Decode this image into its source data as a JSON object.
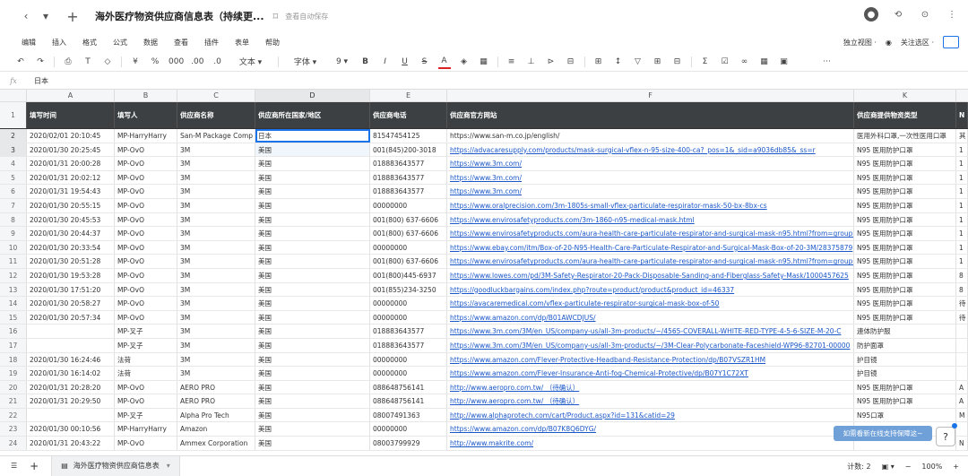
{
  "titlebar": {
    "back": "‹",
    "dropdown": "▾",
    "add": "+",
    "title": "海外医疗物资供应商信息表（持续更...",
    "bookmark": "⌑",
    "autosave": "查看自动保存"
  },
  "menu": {
    "items": [
      "编辑",
      "插入",
      "格式",
      "公式",
      "数据",
      "查看",
      "插件",
      "表单",
      "帮助"
    ],
    "right_view": "独立视图 ·",
    "right_follow": "关注选区 ·"
  },
  "toolbar": {
    "items": [
      "↶",
      "↷",
      "⎙",
      "T",
      "◇",
      "¥",
      "%",
      "000",
      ".00",
      ".0",
      "文本 ▾",
      "字体 ▾",
      "9 ▾",
      "B",
      "I",
      "U",
      "S",
      "A",
      "◈",
      "▦",
      "≡",
      "⊥",
      "⊳",
      "⊟",
      "⊞",
      "↕",
      "▽",
      "⊞",
      "⊟",
      "Σ",
      "☑",
      "∞",
      "▦",
      "▣",
      "···"
    ]
  },
  "formula": {
    "fx": "fx",
    "value": "日本"
  },
  "columns": [
    "A",
    "B",
    "C",
    "D",
    "E",
    "F",
    "",
    "K"
  ],
  "header_row": [
    "填写时间",
    "填写人",
    "供应商名称",
    "供应商所在国家/地区",
    "供应商电话",
    "供应商官方网站",
    "",
    "供应商提供物资类型",
    "N"
  ],
  "rows": [
    {
      "n": "2",
      "a": "2020/02/01 20:10:45",
      "b": "MP-HarryHarry",
      "c": "San-M Package Comp",
      "d": "日本",
      "e": "81547454125",
      "f": "https://www.san-m.co.jp/english/",
      "f_link": false,
      "k": "医用外科口罩,一次性医用口罩",
      "l": "其"
    },
    {
      "n": "3",
      "a": "2020/01/30 20:25:45",
      "b": "MP-OvO",
      "c": "3M",
      "d": "美国",
      "e": "001(845)200-3018",
      "f": "https://advacaresupply.com/products/mask-surgical-vflex-n-95-size-400-ca?_pos=1&_sid=a9036db85&_ss=r",
      "f_link": true,
      "k": "N95 医用防护口罩",
      "l": "1"
    },
    {
      "n": "4",
      "a": "2020/01/31 20:00:28",
      "b": "MP-OvO",
      "c": "3M",
      "d": "美国",
      "e": "018883643577",
      "f": "https://www.3m.com/",
      "f_link": true,
      "k": "N95 医用防护口罩",
      "l": "1"
    },
    {
      "n": "5",
      "a": "2020/01/31 20:02:12",
      "b": "MP-OvO",
      "c": "3M",
      "d": "美国",
      "e": "018883643577",
      "f": "https://www.3m.com/",
      "f_link": true,
      "k": "N95 医用防护口罩",
      "l": "1"
    },
    {
      "n": "6",
      "a": "2020/01/31 19:54:43",
      "b": "MP-OvO",
      "c": "3M",
      "d": "美国",
      "e": "018883643577",
      "f": "https://www.3m.com/",
      "f_link": true,
      "k": "N95 医用防护口罩",
      "l": "1"
    },
    {
      "n": "7",
      "a": "2020/01/30 20:55:15",
      "b": "MP-OvO",
      "c": "3M",
      "d": "美国",
      "e": "00000000",
      "f": "https://www.oralprecision.com/3m-1805s-small-vflex-particulate-respirator-mask-50-bx-8bx-cs",
      "f_link": true,
      "k": "N95 医用防护口罩",
      "l": "1"
    },
    {
      "n": "8",
      "a": "2020/01/30 20:45:53",
      "b": "MP-OvO",
      "c": "3M",
      "d": "美国",
      "e": "001(800) 637-6606",
      "f": "https://www.envirosafetyproducts.com/3m-1860-n95-medical-mask.html",
      "f_link": true,
      "k": "N95 医用防护口罩",
      "l": "1"
    },
    {
      "n": "9",
      "a": "2020/01/30 20:44:37",
      "b": "MP-OvO",
      "c": "3M",
      "d": "美国",
      "e": "001(800) 637-6606",
      "f": "https://www.envirosafetyproducts.com/aura-health-care-particulate-respirator-and-surgical-mask-n95.html?from=groupme",
      "f_link": true,
      "k": "N95 医用防护口罩",
      "l": "1"
    },
    {
      "n": "10",
      "a": "2020/01/30 20:33:54",
      "b": "MP-OvO",
      "c": "3M",
      "d": "美国",
      "e": "00000000",
      "f": "https://www.ebay.com/itm/Box-of-20-N95-Health-Care-Particulate-Respirator-and-Surgical-Mask-Box-of-20-3M/28375879",
      "f_link": true,
      "k": "N95 医用防护口罩",
      "l": "1"
    },
    {
      "n": "11",
      "a": "2020/01/30 20:51:28",
      "b": "MP-OvO",
      "c": "3M",
      "d": "美国",
      "e": "001(800) 637-6606",
      "f": "https://www.envirosafetyproducts.com/aura-health-care-particulate-respirator-and-surgical-mask-n95.html?from=groupme",
      "f_link": true,
      "k": "N95 医用防护口罩",
      "l": "1"
    },
    {
      "n": "12",
      "a": "2020/01/30 19:53:28",
      "b": "MP-OvO",
      "c": "3M",
      "d": "美国",
      "e": "001(800)445-6937",
      "f": "https://www.lowes.com/pd/3M-Safety-Respirator-20-Pack-Disposable-Sanding-and-Fiberglass-Safety-Mask/1000457625",
      "f_link": true,
      "k": "N95 医用防护口罩",
      "l": "8"
    },
    {
      "n": "13",
      "a": "2020/01/30 17:51:20",
      "b": "MP-OvO",
      "c": "3M",
      "d": "美国",
      "e": "001(855)234-3250",
      "f": "https://goodluckbargains.com/index.php?route=product/product&product_id=46337",
      "f_link": true,
      "k": "N95 医用防护口罩",
      "l": "8"
    },
    {
      "n": "14",
      "a": "2020/01/30 20:58:27",
      "b": "MP-OvO",
      "c": "3M",
      "d": "美国",
      "e": "00000000",
      "f": "https://avacaremedical.com/vflex-particulate-respirator-surgical-mask-box-of-50",
      "f_link": true,
      "k": "N95 医用防护口罩",
      "l": "待"
    },
    {
      "n": "15",
      "a": "2020/01/30 20:57:34",
      "b": "MP-OvO",
      "c": "3M",
      "d": "美国",
      "e": "00000000",
      "f": "https://www.amazon.com/dp/B01AWCDJUS/",
      "f_link": true,
      "k": "N95 医用防护口罩",
      "l": "待"
    },
    {
      "n": "16",
      "a": "",
      "b": "MP-叉子",
      "c": "3M",
      "d": "美国",
      "e": "018883643577",
      "f": "https://www.3m.com/3M/en_US/company-us/all-3m-products/~/4565-COVERALL-WHITE-RED-TYPE-4-5-6-SIZE-M-20-C",
      "f_link": true,
      "k": "連体防护服",
      "l": ""
    },
    {
      "n": "17",
      "a": "",
      "b": "MP-叉子",
      "c": "3M",
      "d": "美国",
      "e": "018883643577",
      "f": "https://www.3m.com/3M/en_US/company-us/all-3m-products/~/3M-Clear-Polycarbonate-Faceshield-WP96-82701-00000",
      "f_link": true,
      "k": "防护面罩",
      "l": ""
    },
    {
      "n": "18",
      "a": "2020/01/30 16:24:46",
      "b": "法荷",
      "c": "3M",
      "d": "美国",
      "e": "00000000",
      "f": "https://www.amazon.com/Flever-Protective-Headband-Resistance-Protection/dp/B07VSZR1HM",
      "f_link": true,
      "k": "护目镜",
      "l": ""
    },
    {
      "n": "19",
      "a": "2020/01/30 16:14:02",
      "b": "法荷",
      "c": "3M",
      "d": "美国",
      "e": "00000000",
      "f": "https://www.amazon.com/Flever-Insurance-Anti-fog-Chemical-Protective/dp/B07Y1C72XT",
      "f_link": true,
      "k": "护目镜",
      "l": ""
    },
    {
      "n": "20",
      "a": "2020/01/31 20:28:20",
      "b": "MP-OvO",
      "c": "AERO PRO",
      "d": "美国",
      "e": "088648756141",
      "f": "http://www.aeropro.com.tw/ （待确认）",
      "f_link": true,
      "k": "N95 医用防护口罩",
      "l": "A"
    },
    {
      "n": "21",
      "a": "2020/01/31 20:29:50",
      "b": "MP-OvO",
      "c": "AERO PRO",
      "d": "美国",
      "e": "088648756141",
      "f": "http://www.aeropro.com.tw/ （待确认）",
      "f_link": true,
      "k": "N95 医用防护口罩",
      "l": "A"
    },
    {
      "n": "22",
      "a": "",
      "b": "MP-叉子",
      "c": "Alpha Pro Tech",
      "d": "美国",
      "e": "08007491363",
      "f": "http://www.alphaprotech.com/cart/Product.aspx?id=131&catid=29",
      "f_link": true,
      "k": "N95口罩",
      "l": "M"
    },
    {
      "n": "23",
      "a": "2020/01/30 00:10:56",
      "b": "MP-HarryHarry",
      "c": "Amazon",
      "d": "美国",
      "e": "00000000",
      "f": "https://www.amazon.com/dp/B07K8Q6DYG/",
      "f_link": true,
      "k": "",
      "l": ""
    },
    {
      "n": "24",
      "a": "2020/01/31 20:43:22",
      "b": "MP-OvO",
      "c": "Ammex Corporation",
      "d": "美国",
      "e": "08003799929",
      "f": "http://www.makrite.com/",
      "f_link": true,
      "k": "",
      "l": "N"
    }
  ],
  "bottom": {
    "sheet_name": "海外医疗物资供应商信息表",
    "count": "计数: 2",
    "zoom": "100%"
  },
  "toast": "如需看新在线支持保障这~"
}
